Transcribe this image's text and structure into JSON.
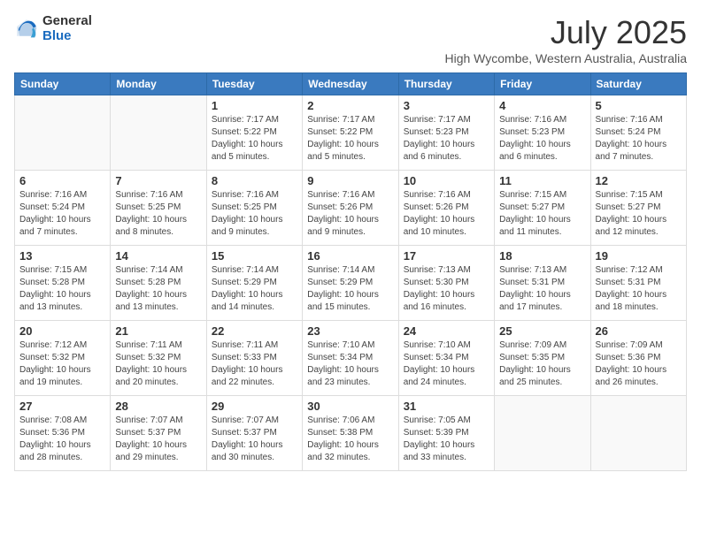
{
  "header": {
    "logo_general": "General",
    "logo_blue": "Blue",
    "month_title": "July 2025",
    "location": "High Wycombe, Western Australia, Australia"
  },
  "weekdays": [
    "Sunday",
    "Monday",
    "Tuesday",
    "Wednesday",
    "Thursday",
    "Friday",
    "Saturday"
  ],
  "weeks": [
    [
      {
        "day": "",
        "empty": true
      },
      {
        "day": "",
        "empty": true
      },
      {
        "day": "1",
        "sunrise": "7:17 AM",
        "sunset": "5:22 PM",
        "daylight": "10 hours and 5 minutes."
      },
      {
        "day": "2",
        "sunrise": "7:17 AM",
        "sunset": "5:22 PM",
        "daylight": "10 hours and 5 minutes."
      },
      {
        "day": "3",
        "sunrise": "7:17 AM",
        "sunset": "5:23 PM",
        "daylight": "10 hours and 6 minutes."
      },
      {
        "day": "4",
        "sunrise": "7:16 AM",
        "sunset": "5:23 PM",
        "daylight": "10 hours and 6 minutes."
      },
      {
        "day": "5",
        "sunrise": "7:16 AM",
        "sunset": "5:24 PM",
        "daylight": "10 hours and 7 minutes."
      }
    ],
    [
      {
        "day": "6",
        "sunrise": "7:16 AM",
        "sunset": "5:24 PM",
        "daylight": "10 hours and 7 minutes."
      },
      {
        "day": "7",
        "sunrise": "7:16 AM",
        "sunset": "5:25 PM",
        "daylight": "10 hours and 8 minutes."
      },
      {
        "day": "8",
        "sunrise": "7:16 AM",
        "sunset": "5:25 PM",
        "daylight": "10 hours and 9 minutes."
      },
      {
        "day": "9",
        "sunrise": "7:16 AM",
        "sunset": "5:26 PM",
        "daylight": "10 hours and 9 minutes."
      },
      {
        "day": "10",
        "sunrise": "7:16 AM",
        "sunset": "5:26 PM",
        "daylight": "10 hours and 10 minutes."
      },
      {
        "day": "11",
        "sunrise": "7:15 AM",
        "sunset": "5:27 PM",
        "daylight": "10 hours and 11 minutes."
      },
      {
        "day": "12",
        "sunrise": "7:15 AM",
        "sunset": "5:27 PM",
        "daylight": "10 hours and 12 minutes."
      }
    ],
    [
      {
        "day": "13",
        "sunrise": "7:15 AM",
        "sunset": "5:28 PM",
        "daylight": "10 hours and 13 minutes."
      },
      {
        "day": "14",
        "sunrise": "7:14 AM",
        "sunset": "5:28 PM",
        "daylight": "10 hours and 13 minutes."
      },
      {
        "day": "15",
        "sunrise": "7:14 AM",
        "sunset": "5:29 PM",
        "daylight": "10 hours and 14 minutes."
      },
      {
        "day": "16",
        "sunrise": "7:14 AM",
        "sunset": "5:29 PM",
        "daylight": "10 hours and 15 minutes."
      },
      {
        "day": "17",
        "sunrise": "7:13 AM",
        "sunset": "5:30 PM",
        "daylight": "10 hours and 16 minutes."
      },
      {
        "day": "18",
        "sunrise": "7:13 AM",
        "sunset": "5:31 PM",
        "daylight": "10 hours and 17 minutes."
      },
      {
        "day": "19",
        "sunrise": "7:12 AM",
        "sunset": "5:31 PM",
        "daylight": "10 hours and 18 minutes."
      }
    ],
    [
      {
        "day": "20",
        "sunrise": "7:12 AM",
        "sunset": "5:32 PM",
        "daylight": "10 hours and 19 minutes."
      },
      {
        "day": "21",
        "sunrise": "7:11 AM",
        "sunset": "5:32 PM",
        "daylight": "10 hours and 20 minutes."
      },
      {
        "day": "22",
        "sunrise": "7:11 AM",
        "sunset": "5:33 PM",
        "daylight": "10 hours and 22 minutes."
      },
      {
        "day": "23",
        "sunrise": "7:10 AM",
        "sunset": "5:34 PM",
        "daylight": "10 hours and 23 minutes."
      },
      {
        "day": "24",
        "sunrise": "7:10 AM",
        "sunset": "5:34 PM",
        "daylight": "10 hours and 24 minutes."
      },
      {
        "day": "25",
        "sunrise": "7:09 AM",
        "sunset": "5:35 PM",
        "daylight": "10 hours and 25 minutes."
      },
      {
        "day": "26",
        "sunrise": "7:09 AM",
        "sunset": "5:36 PM",
        "daylight": "10 hours and 26 minutes."
      }
    ],
    [
      {
        "day": "27",
        "sunrise": "7:08 AM",
        "sunset": "5:36 PM",
        "daylight": "10 hours and 28 minutes."
      },
      {
        "day": "28",
        "sunrise": "7:07 AM",
        "sunset": "5:37 PM",
        "daylight": "10 hours and 29 minutes."
      },
      {
        "day": "29",
        "sunrise": "7:07 AM",
        "sunset": "5:37 PM",
        "daylight": "10 hours and 30 minutes."
      },
      {
        "day": "30",
        "sunrise": "7:06 AM",
        "sunset": "5:38 PM",
        "daylight": "10 hours and 32 minutes."
      },
      {
        "day": "31",
        "sunrise": "7:05 AM",
        "sunset": "5:39 PM",
        "daylight": "10 hours and 33 minutes."
      },
      {
        "day": "",
        "empty": true
      },
      {
        "day": "",
        "empty": true
      }
    ]
  ],
  "labels": {
    "sunrise_prefix": "Sunrise: ",
    "sunset_prefix": "Sunset: ",
    "daylight_prefix": "Daylight: "
  }
}
